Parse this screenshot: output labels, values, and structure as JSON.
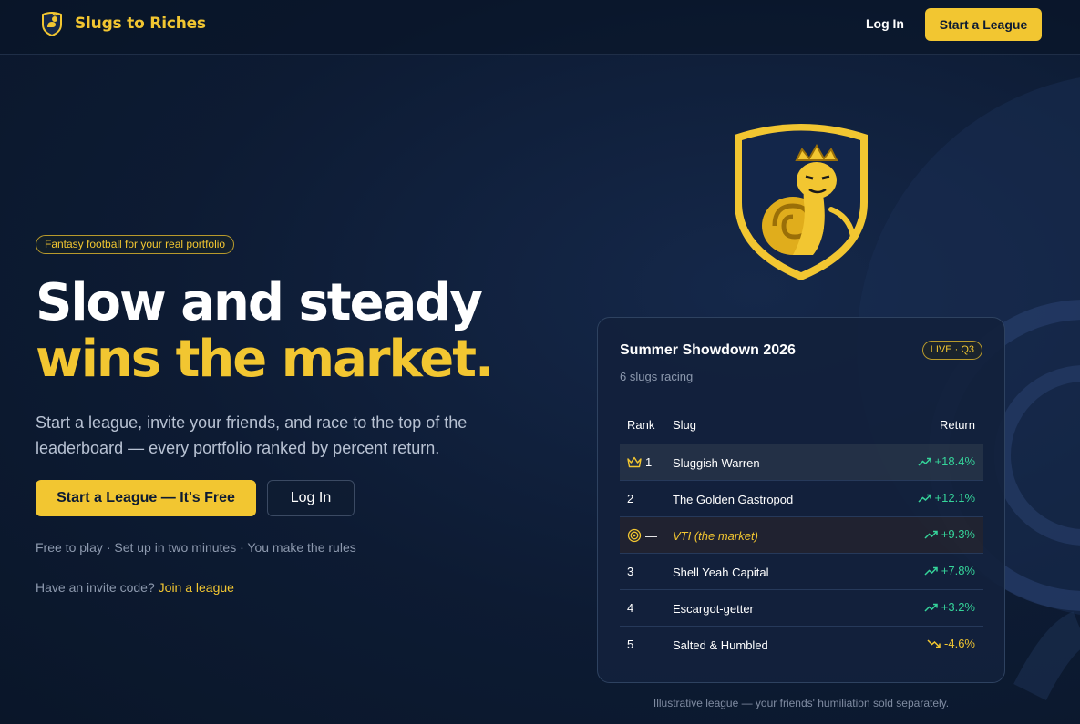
{
  "header": {
    "brand_name": "Slugs to Riches",
    "login_label": "Log In",
    "cta_label": "Start a League"
  },
  "hero": {
    "pill": "Fantasy football for your real portfolio",
    "headline_line1": "Slow and steady",
    "headline_line2": "wins the market.",
    "lead": "Start a league, invite your friends, and race to the top of the leaderboard — every portfolio ranked by percent return.",
    "cta_primary": "Start a League — It's Free",
    "cta_secondary": "Log In",
    "note": "Free to play · Set up in two minutes · You make the rules",
    "invite_prefix": "Have an invite code?",
    "invite_link": "Join a league"
  },
  "league_card": {
    "title": "Summer Showdown 2026",
    "badge": "LIVE · Q3",
    "subtitle": "6 slugs racing",
    "columns": {
      "rank": "Rank",
      "slug": "Slug",
      "return": "Return"
    },
    "rows": [
      {
        "rank": "1",
        "icon": "crown-icon",
        "name": "Sluggish Warren",
        "return": "+18.4%",
        "trend": "up"
      },
      {
        "rank": "2",
        "name": "The Golden Gastropod",
        "return": "+12.1%",
        "trend": "up"
      },
      {
        "rank": "—",
        "icon": "target-icon",
        "name": "VTI (the market)",
        "return": "+9.3%",
        "trend": "up"
      },
      {
        "rank": "3",
        "name": "Shell Yeah Capital",
        "return": "+7.8%",
        "trend": "up"
      },
      {
        "rank": "4",
        "name": "Escargot-getter",
        "return": "+3.2%",
        "trend": "up"
      },
      {
        "rank": "5",
        "name": "Salted & Humbled",
        "return": "-4.6%",
        "trend": "down"
      }
    ],
    "caption": "Illustrative league — your friends' humiliation sold separately."
  },
  "colors": {
    "accent": "#f2c631",
    "background": "#0d1b33",
    "positive": "#35d49a",
    "negative": "#f2c631"
  }
}
